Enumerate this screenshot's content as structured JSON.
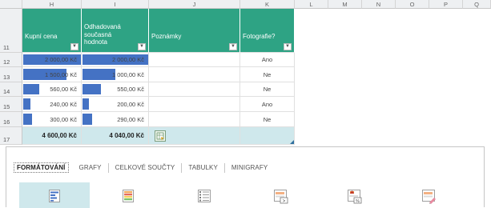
{
  "columns": [
    "H",
    "I",
    "J",
    "K",
    "L",
    "M",
    "N",
    "O",
    "P",
    "Q"
  ],
  "rows": [
    "11",
    "12",
    "13",
    "14",
    "15",
    "16",
    "17"
  ],
  "headers": {
    "purchase_price": "Kupní cena",
    "estimated_value": "Odhadovaná současná hodnota",
    "notes": "Poznámky",
    "photo": "Fotografie?"
  },
  "filter_glyph": "▼",
  "data_rows": [
    {
      "purchase_price": "2 000,00 Kč",
      "purchase_bar": 1.0,
      "estimated_value": "2 000,00 Kč",
      "estimated_bar": 1.0,
      "notes": "",
      "photo": "Ano"
    },
    {
      "purchase_price": "1 500,00 Kč",
      "purchase_bar": 0.75,
      "estimated_value": "1 000,00 Kč",
      "estimated_bar": 0.5,
      "notes": "",
      "photo": "Ne"
    },
    {
      "purchase_price": "560,00 Kč",
      "purchase_bar": 0.28,
      "estimated_value": "550,00 Kč",
      "estimated_bar": 0.275,
      "notes": "",
      "photo": "Ne"
    },
    {
      "purchase_price": "240,00 Kč",
      "purchase_bar": 0.12,
      "estimated_value": "200,00 Kč",
      "estimated_bar": 0.1,
      "notes": "",
      "photo": "Ano"
    },
    {
      "purchase_price": "300,00 Kč",
      "purchase_bar": 0.15,
      "estimated_value": "290,00 Kč",
      "estimated_bar": 0.145,
      "notes": "",
      "photo": "Ne"
    }
  ],
  "totals": {
    "purchase_price": "4 600,00 Kč",
    "estimated_value": "4 040,00 Kč"
  },
  "quick_analysis": {
    "tabs": [
      "FORMÁTOVÁNÍ",
      "GRAFY",
      "CELKOVÉ SOUČTY",
      "TABULKY",
      "MINIGRAFY"
    ],
    "active_tab": "FORMÁTOVÁNÍ",
    "options": [
      {
        "icon": "data-bars-icon",
        "selected": true
      },
      {
        "icon": "color-scale-icon",
        "selected": false
      },
      {
        "icon": "icon-set-icon",
        "selected": false
      },
      {
        "icon": "greater-than-icon",
        "selected": false
      },
      {
        "icon": "top-percent-icon",
        "selected": false
      },
      {
        "icon": "clear-format-icon",
        "selected": false
      }
    ]
  },
  "colors": {
    "header_green": "#2ea384",
    "data_bar": "#4472c4",
    "total_row": "#cfe8ec",
    "selected_option": "#cfe8ec"
  }
}
